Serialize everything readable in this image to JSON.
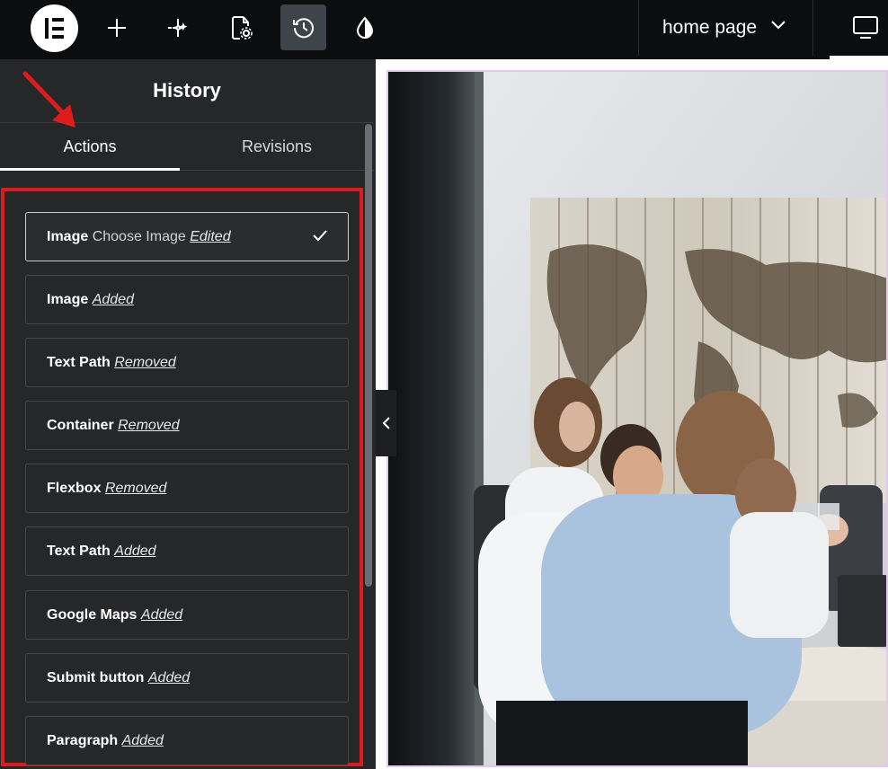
{
  "topbar": {
    "logo_icon": "elementor-logo-icon",
    "tools": [
      {
        "name": "add-element",
        "icon": "plus-icon"
      },
      {
        "name": "ai",
        "icon": "sparkle-icon"
      },
      {
        "name": "page-settings",
        "icon": "page-settings-icon"
      },
      {
        "name": "history",
        "icon": "history-icon",
        "active": true
      },
      {
        "name": "site-settings",
        "icon": "droplet-icon"
      }
    ],
    "page_selector": {
      "label": "home page",
      "icon": "chevron-down-icon"
    },
    "device_icon": "desktop-icon"
  },
  "panel": {
    "title": "History",
    "tabs": [
      {
        "label": "Actions",
        "active": true
      },
      {
        "label": "Revisions",
        "active": false
      }
    ],
    "items": [
      {
        "title": "Image",
        "subtitle": "Choose Image",
        "action": "Edited",
        "current": true
      },
      {
        "title": "Image",
        "subtitle": "",
        "action": "Added",
        "current": false
      },
      {
        "title": "Text Path",
        "subtitle": "",
        "action": "Removed",
        "current": false
      },
      {
        "title": "Container",
        "subtitle": "",
        "action": "Removed",
        "current": false
      },
      {
        "title": "Flexbox",
        "subtitle": "",
        "action": "Removed",
        "current": false
      },
      {
        "title": "Text Path",
        "subtitle": "",
        "action": "Added",
        "current": false
      },
      {
        "title": "Google Maps",
        "subtitle": "",
        "action": "Added",
        "current": false
      },
      {
        "title": "Submit button",
        "subtitle": "",
        "action": "Added",
        "current": false
      },
      {
        "title": "Paragraph",
        "subtitle": "",
        "action": "Added",
        "current": false
      }
    ]
  },
  "annotation_color": "#e01b1b",
  "canvas": {
    "image_description_icon": "office-meeting-photo"
  }
}
